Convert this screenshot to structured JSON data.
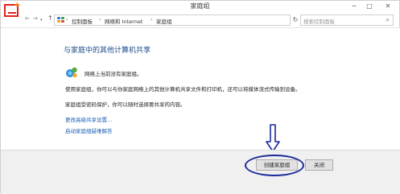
{
  "window": {
    "title": "家庭组",
    "minimize": "─",
    "maximize": "□",
    "close": "✕"
  },
  "nav": {
    "back": "←",
    "forward": "→",
    "dropdown": "▾",
    "up": "↑"
  },
  "address": {
    "crumbs": [
      "控制面板",
      "网络和 Internet",
      "家庭组"
    ],
    "separator": "›",
    "dropdown": "▾",
    "refresh": "↻"
  },
  "search": {
    "placeholder": "搜索控制面板",
    "icon": "⌕"
  },
  "main": {
    "heading": "与家庭中的其他计算机共享",
    "status": "网络上当前没有家庭组。",
    "description1": "使用家庭组，你可以与你家庭网络上的其他计算机共享文件和打印机，还可以将媒体流式传输到设备。",
    "description2": "家庭组受密码保护，你可以随时选择要共享的内容。",
    "link_advanced": "更改高级共享设置...",
    "link_troubleshoot": "启动家庭组疑难解答"
  },
  "footer": {
    "create_button": "创建家庭组",
    "close_button": "关闭"
  },
  "colors": {
    "heading": "#1e4e8c",
    "link": "#1a5fb4",
    "annotation": "#1a2a9a",
    "logo_red": "#e2231a",
    "logo_orange": "#ff8a00"
  }
}
